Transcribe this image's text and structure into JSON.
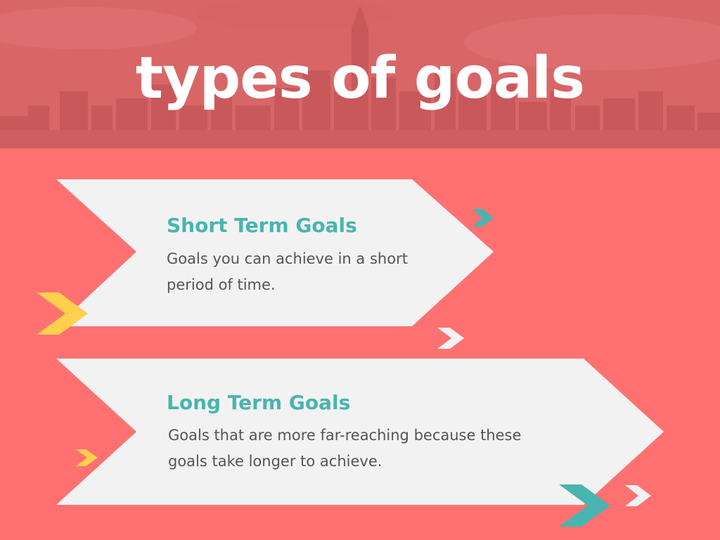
{
  "header": {
    "title": "types of goals",
    "background": "city-skyline-image"
  },
  "cards": [
    {
      "title": "Short Term Goals",
      "description": "Goals you can achieve in a short period of time."
    },
    {
      "title": "Long Term Goals",
      "description": "Goals that are more far-reaching because these goals take longer to achieve."
    }
  ],
  "colors": {
    "background": "#FF7171",
    "header_tint": "#D96667",
    "card": "#F2F2F2",
    "accent_teal": "#48B5B0",
    "accent_yellow": "#FFD04D",
    "text": "#555555",
    "title": "#FFFFFF"
  },
  "decorations": [
    "chevron-teal-icon",
    "chevron-yellow-icon",
    "chevron-white-icon"
  ]
}
